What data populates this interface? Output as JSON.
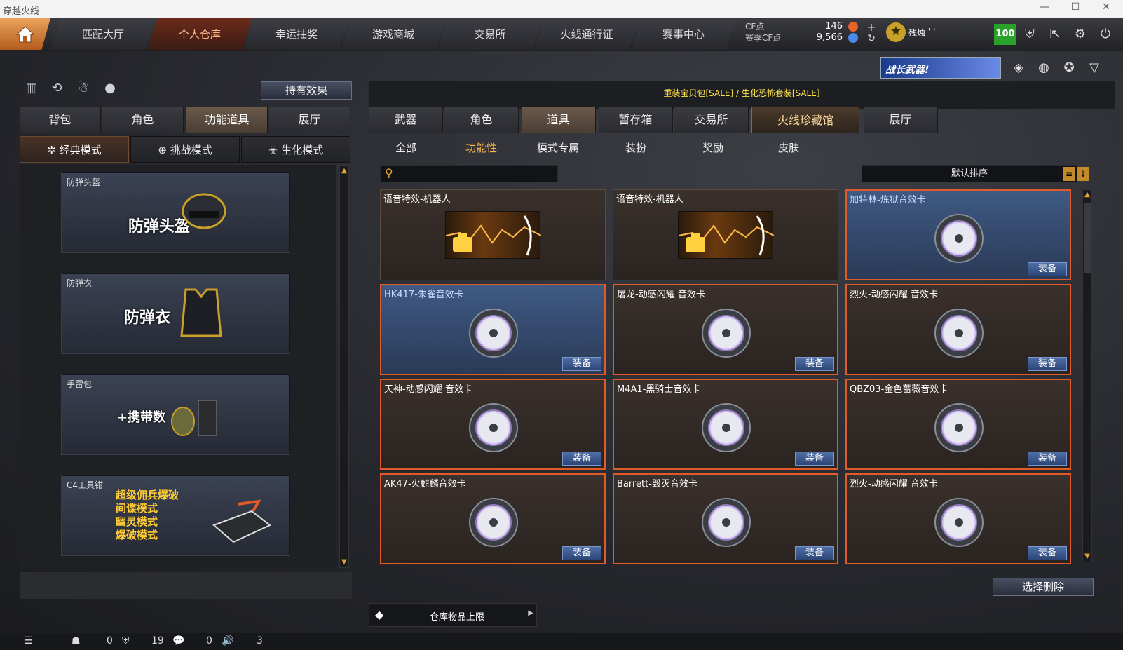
{
  "window": {
    "title": "穿越火线",
    "controls": [
      "—",
      "☐",
      "✕"
    ]
  },
  "nav": {
    "tabs": [
      "匹配大厅",
      "个人仓库",
      "幸运抽奖",
      "游戏商城",
      "交易所",
      "火线通行证",
      "赛事中心"
    ],
    "active": 1
  },
  "currency": {
    "cf_label": "CF点",
    "season_label": "赛季CF点",
    "cf_value": "146",
    "season_value": "9,566"
  },
  "player": {
    "name": "残烛",
    "suffix": "' '",
    "level": "100"
  },
  "banner": {
    "text": "战长武器!"
  },
  "left": {
    "effect_button": "持有效果",
    "tabs": [
      "背包",
      "角色",
      "功能道具",
      "展厅"
    ],
    "active_tab": 2,
    "modes": [
      "经典模式",
      "挑战模式",
      "生化模式"
    ],
    "active_mode": 0,
    "items": [
      {
        "name": "防弹头盔",
        "big": "防弹头盔"
      },
      {
        "name": "防弹衣",
        "big": "防弹衣"
      },
      {
        "name": "手雷包",
        "big": "+携带数"
      },
      {
        "name": "C4工具钳",
        "lines": [
          "超级佣兵爆破",
          "间谍模式",
          "幽灵模式",
          "爆破模式"
        ]
      }
    ]
  },
  "right": {
    "sale_text": "重装宝贝包[SALE] / 生化恐怖套装[SALE]",
    "tabs": [
      "武器",
      "角色",
      "道具",
      "暂存箱",
      "交易所",
      "火线珍藏馆",
      "展厅"
    ],
    "active_tab": 2,
    "subtabs": [
      "全部",
      "功能性",
      "模式专属",
      "装扮",
      "奖励",
      "皮肤"
    ],
    "active_subtab": 1,
    "search_placeholder": "",
    "sort_label": "默认排序",
    "equip_label": "装备",
    "cards": [
      {
        "name": "语音特效-机器人",
        "type": "voice",
        "equip": false,
        "style": "normal"
      },
      {
        "name": "语音特效-机器人",
        "type": "voice",
        "equip": false,
        "style": "normal"
      },
      {
        "name": "加特林-炼狱音效卡",
        "type": "disc",
        "equip": true,
        "style": "blue"
      },
      {
        "name": "HK417-朱雀音效卡",
        "type": "disc",
        "equip": true,
        "style": "blue"
      },
      {
        "name": "屠龙-动感闪耀 音效卡",
        "type": "disc",
        "equip": true,
        "style": "normal"
      },
      {
        "name": "烈火-动感闪耀 音效卡",
        "type": "disc",
        "equip": true,
        "style": "normal"
      },
      {
        "name": "天神-动感闪耀 音效卡",
        "type": "disc",
        "equip": true,
        "style": "normal"
      },
      {
        "name": "M4A1-黑骑士音效卡",
        "type": "disc",
        "equip": true,
        "style": "normal"
      },
      {
        "name": "QBZ03-金色蔷薇音效卡",
        "type": "disc",
        "equip": true,
        "style": "normal"
      },
      {
        "name": "AK47-火麒麟音效卡",
        "type": "disc",
        "equip": true,
        "style": "normal"
      },
      {
        "name": "Barrett-毁灭音效卡",
        "type": "disc",
        "equip": true,
        "style": "normal"
      },
      {
        "name": "烈火-动感闪耀 音效卡",
        "type": "disc",
        "equip": true,
        "style": "normal"
      }
    ],
    "delete_button": "选择删除",
    "capacity_label": "仓库物品上限"
  },
  "status": {
    "friends": "0",
    "clan": "19",
    "chat": "0",
    "voice": "3"
  }
}
